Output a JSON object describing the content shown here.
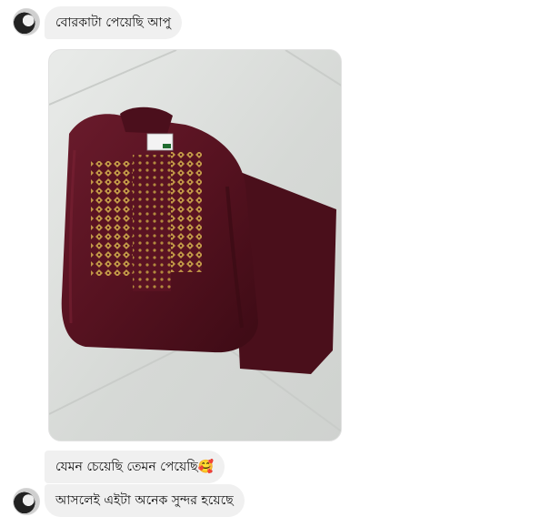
{
  "chat": {
    "messages": [
      {
        "type": "text",
        "text": "বোরকাটা পেয়েছি আপু"
      },
      {
        "type": "image",
        "icon": "photo-attachment"
      },
      {
        "type": "text",
        "text": "যেমন চেয়েছি তেমন পেয়েছি🥰"
      },
      {
        "type": "text",
        "text": "আসলেই এইটা অনেক সুন্দর হয়েছে"
      }
    ]
  },
  "colors": {
    "bubble_bg": "#f0f0f0",
    "garment": "#5a1322",
    "embroidery": "#c9a24a"
  }
}
